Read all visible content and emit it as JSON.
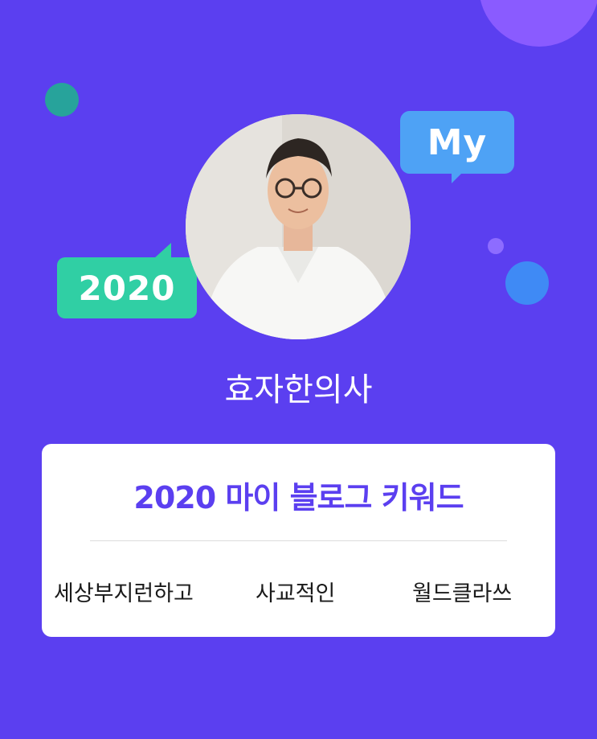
{
  "profile": {
    "name": "효자한의사",
    "avatar_alt": "profile photo"
  },
  "bubbles": {
    "my_label": "My",
    "year_label": "2020"
  },
  "card": {
    "title": "2020 마이 블로그 키워드",
    "keywords": [
      "세상부지런하고",
      "사교적인",
      "월드클라쓰"
    ]
  },
  "colors": {
    "background": "#5b3ff0",
    "title": "#5b3ff0",
    "my_bubble": "#4ea2f5",
    "year_bubble": "#30cfa4",
    "card": "#ffffff"
  }
}
